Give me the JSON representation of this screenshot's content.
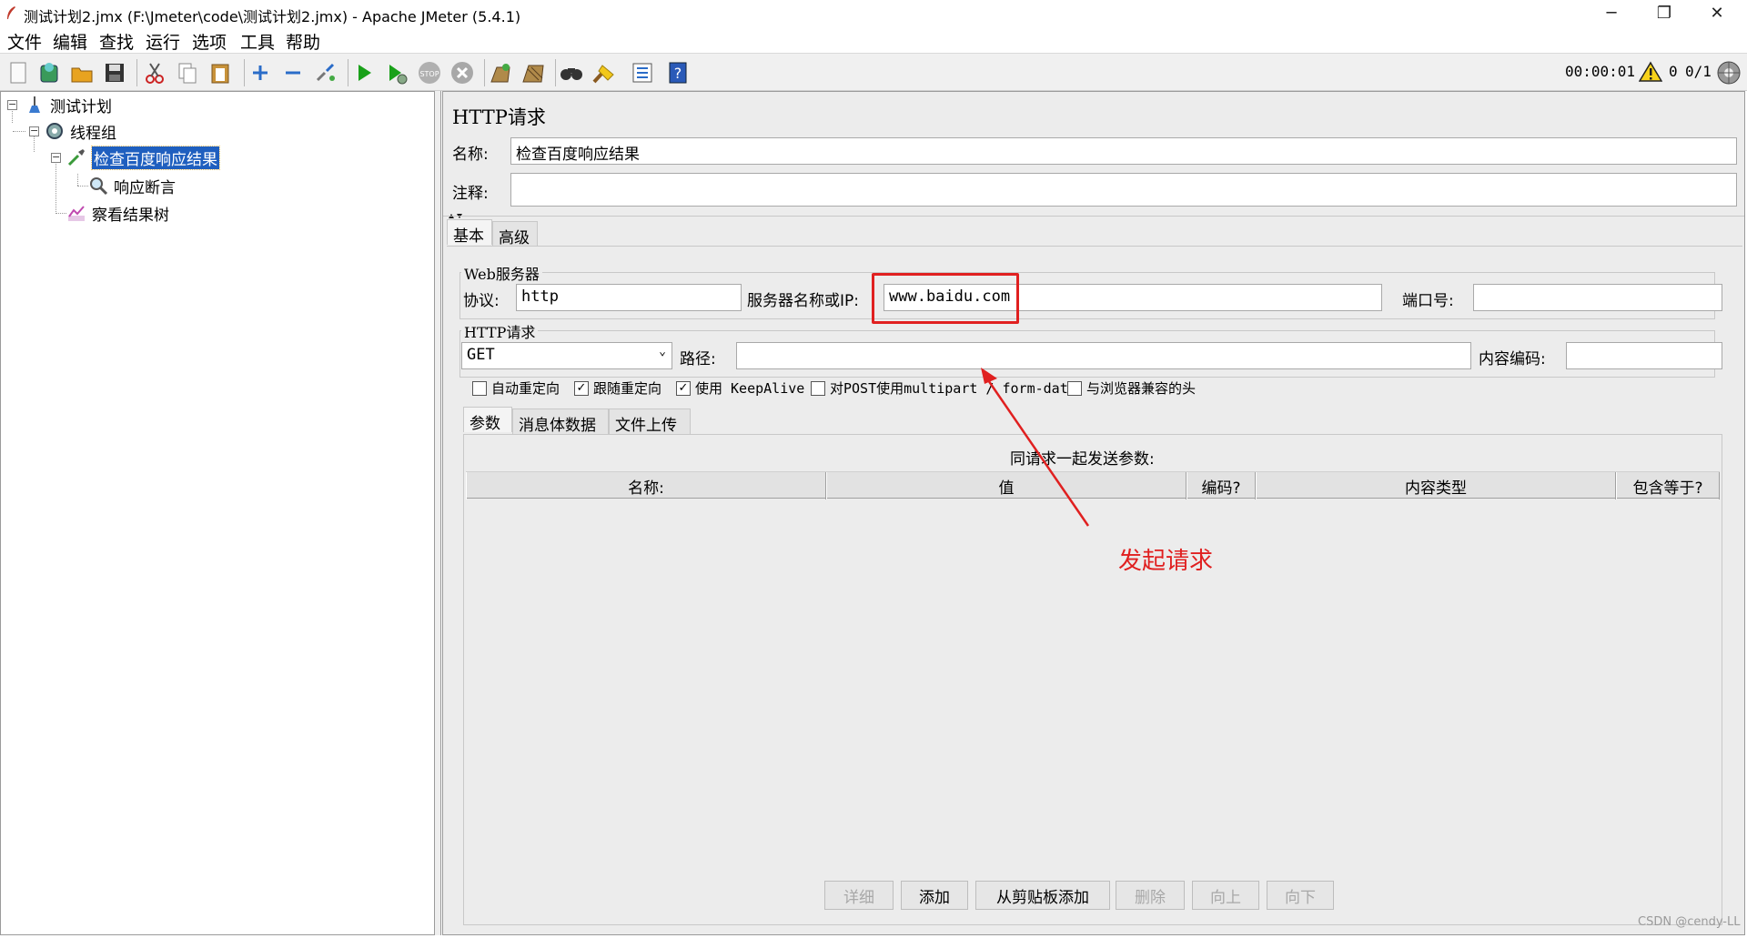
{
  "window": {
    "title": "测试计划2.jmx (F:\\Jmeter\\code\\测试计划2.jmx) - Apache JMeter (5.4.1)",
    "minimize": "─",
    "restore": "❐",
    "close": "✕"
  },
  "menu": [
    "文件",
    "编辑",
    "查找",
    "运行",
    "选项",
    "工具",
    "帮助"
  ],
  "toolbar": {
    "icons": [
      "new-icon",
      "templates-icon",
      "open-icon",
      "save-icon",
      "cut-icon",
      "copy-icon",
      "paste-icon",
      "expand-icon",
      "collapse-icon",
      "toggle-icon",
      "start-icon",
      "start-no-pause-icon",
      "stop-icon",
      "shutdown-icon",
      "clear-icon",
      "clear-all-icon",
      "search-icon",
      "reset-search-icon",
      "function-helper-icon",
      "help-icon"
    ],
    "timer": "00:00:01",
    "error_count": "0",
    "threads": "0/1"
  },
  "tree": {
    "plan": "测试计划",
    "thread_group": "线程组",
    "sampler": "检查百度响应结果",
    "assertion": "响应断言",
    "listener": "察看结果树"
  },
  "panel": {
    "title": "HTTP请求",
    "name_label": "名称:",
    "name_value": "检查百度响应结果",
    "comment_label": "注释:",
    "comment_value": "",
    "tabs": [
      "基本",
      "高级"
    ],
    "web_server": {
      "title": "Web服务器",
      "protocol_label": "协议:",
      "protocol_value": "http",
      "server_label": "服务器名称或IP:",
      "server_value": "www.baidu.com",
      "port_label": "端口号:",
      "port_value": ""
    },
    "http_request": {
      "title": "HTTP请求",
      "method": "GET",
      "path_label": "路径:",
      "path_value": "",
      "encoding_label": "内容编码:",
      "encoding_value": ""
    },
    "checkboxes": [
      {
        "label": "自动重定向",
        "checked": false
      },
      {
        "label": "跟随重定向",
        "checked": true
      },
      {
        "label": "使用 KeepAlive",
        "checked": true
      },
      {
        "label": "对POST使用multipart / form-data",
        "checked": false
      },
      {
        "label": "与浏览器兼容的头",
        "checked": false
      }
    ],
    "sub_tabs": [
      "参数",
      "消息体数据",
      "文件上传"
    ],
    "params_caption": "同请求一起发送参数:",
    "columns": [
      "名称:",
      "值",
      "编码?",
      "内容类型",
      "包含等于?"
    ],
    "buttons": {
      "detail": "详细",
      "add": "添加",
      "add_clipboard": "从剪贴板添加",
      "delete": "删除",
      "up": "向上",
      "down": "向下"
    }
  },
  "annotation": {
    "text": "发起请求",
    "color": "#e02020"
  },
  "watermark": "CSDN @cendy-LL"
}
